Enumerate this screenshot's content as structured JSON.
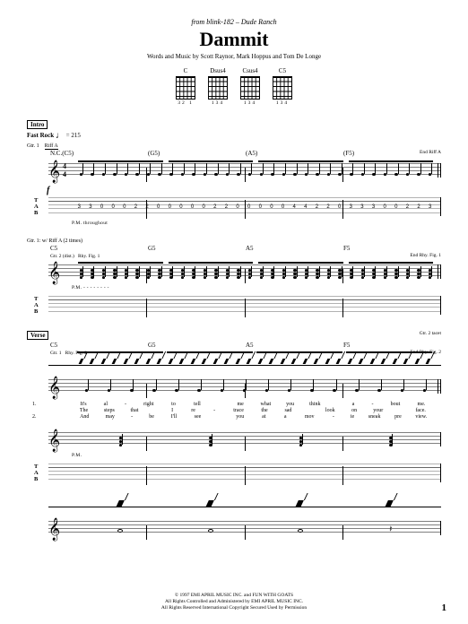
{
  "source": "from blink-182 – Dude Ranch",
  "title": "Dammit",
  "credits": "Words and Music by Scott Raynor, Mark Hoppus and Tom De Longe",
  "chord_diagrams": [
    {
      "name": "C",
      "frets": "32 1"
    },
    {
      "name": "Dsus4",
      "frets": "134"
    },
    {
      "name": "Csus4",
      "frets": "134"
    },
    {
      "name": "C5",
      "frets": "134"
    }
  ],
  "sections": {
    "intro": {
      "label": "Intro",
      "tempo_label": "Fast Rock",
      "tempo_bpm": "215",
      "gtr1": "Gtr. 1",
      "riff_a": "Riff A",
      "end_riff_a": "End Riff A",
      "chords": [
        "N.C.(C5)",
        "(G5)",
        "(A5)",
        "(F5)"
      ],
      "timesig_top": "4",
      "timesig_bot": "4",
      "dynamic": "f",
      "pm_text": "P.M. throughout",
      "tab_pattern": [
        [
          "",
          "0",
          "3",
          "0",
          "3",
          "0",
          "2",
          "0"
        ],
        [
          "",
          "",
          "",
          "",
          "",
          "",
          "",
          ""
        ],
        [
          "",
          "",
          "",
          "",
          "",
          "",
          "",
          ""
        ],
        [
          "",
          "",
          "",
          "",
          "",
          "",
          "",
          ""
        ]
      ],
      "tab_seq": {
        "c5": {
          "notes": [
            [
              "3",
              " "
            ],
            [
              "3",
              " "
            ],
            [
              "3",
              "0"
            ],
            [
              "",
              "0"
            ],
            [
              "",
              "0"
            ],
            [
              "",
              "2"
            ],
            [
              "",
              "2"
            ],
            [
              "",
              "0"
            ]
          ]
        },
        "g5": {
          "notes": [
            [
              "",
              "0"
            ],
            [
              "",
              "0"
            ],
            [
              "",
              "0"
            ],
            [
              "",
              "0"
            ],
            [
              "",
              "2"
            ],
            [
              "",
              "2"
            ],
            [
              "",
              "0"
            ],
            [
              "",
              "0"
            ]
          ]
        },
        "a5": {
          "notes": [
            [
              "",
              "0"
            ],
            [
              "",
              "0"
            ],
            [
              "",
              "0"
            ],
            [
              "",
              "4"
            ],
            [
              "",
              "4"
            ],
            [
              "",
              "2"
            ],
            [
              "",
              "2"
            ],
            [
              "",
              "0"
            ]
          ]
        },
        "f5": {
          "notes": [
            [
              "",
              "3"
            ],
            [
              "",
              "3"
            ],
            [
              "",
              "3"
            ],
            [
              "",
              "0"
            ],
            [
              "",
              "0"
            ],
            [
              "",
              "2"
            ],
            [
              "",
              "2"
            ],
            [
              "",
              "3"
            ]
          ]
        }
      }
    },
    "intro2": {
      "gtr1_note": "Gtr. 1: w/ Riff A (2 times)",
      "chords": [
        "C5",
        "G5",
        "A5",
        "F5"
      ],
      "gtr2": "Gtr. 2 (dist.)",
      "rhy_fig": "Rhy. Fig. 1",
      "end_rhy_fig": "End Rhy. Fig. 1",
      "pm": "P.M.",
      "pm_dashes": "- - - - - - - -"
    },
    "verse": {
      "label": "Verse",
      "chords": [
        "C5",
        "G5",
        "A5",
        "F5"
      ],
      "gtr2_tacet": "Gtr. 2 tacet",
      "gtr1": "Gtr. 1",
      "rhy_fig": "Rhy. Fig. 2",
      "end_rhy_fig": "End Rhy. Fig. 2",
      "lyrics": [
        {
          "n": "1.",
          "words": [
            [
              "It's",
              "al",
              "-",
              "right"
            ],
            [
              "to",
              "tell",
              "",
              "me"
            ],
            [
              "what",
              "you",
              "think",
              ""
            ],
            [
              "a",
              "-",
              "bout",
              "me."
            ]
          ]
        },
        {
          "n": "",
          "words": [
            [
              "The",
              "steps",
              "that",
              ""
            ],
            [
              "I",
              "re",
              "-",
              "trace"
            ],
            [
              "the",
              "sad",
              "",
              "look"
            ],
            [
              "on",
              "your",
              "",
              "face."
            ]
          ]
        },
        {
          "n": "2.",
          "words": [
            [
              "And",
              "may",
              "-",
              "be"
            ],
            [
              "I'll",
              "see",
              "",
              "you"
            ],
            [
              "at",
              "a",
              "mov",
              "-"
            ],
            [
              "ie",
              "sneak",
              "pre",
              "view."
            ]
          ]
        }
      ],
      "pm": "P.M."
    }
  },
  "footer": {
    "line1": "© 1997 EMI APRIL MUSIC INC. and FUN WITH GOATS",
    "line2": "All Rights Controlled and Administered by EMI APRIL MUSIC INC.",
    "line3": "All Rights Reserved   International Copyright Secured   Used by Permission"
  },
  "page_number": "1",
  "tab_label": {
    "t": "T",
    "a": "A",
    "b": "B"
  }
}
